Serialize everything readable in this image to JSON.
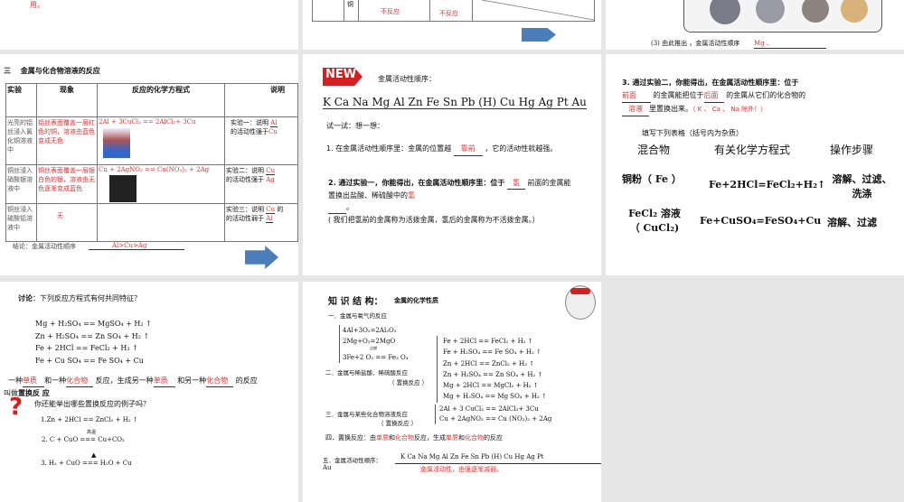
{
  "slides": [
    {
      "id": "top-left",
      "text": "用。"
    },
    {
      "id": "top-middle",
      "cell_label": "铜",
      "no_react1": "不反应",
      "no_react2": "不反应"
    },
    {
      "id": "top-right",
      "text": "(3) 由此推出 ，金属活动性顺序",
      "answer": "Mg 、"
    },
    {
      "id": "slide-metal-solution",
      "title": "三　 金属与化合物溶液的反应",
      "headers": [
        "实验",
        "现象",
        "反应的化学方程式",
        "说明"
      ],
      "rows": [
        {
          "exp": "光亮的铝丝浸入氯化铜溶液中",
          "phen": "铝丝表面覆盖一层红色的铜，溶液由蓝色变成无色",
          "eq": "2Al + 3CuCl₂ == 2AlCl₃+ 3Cu",
          "note": "实验一：说明",
          "note2": "的活动性强于",
          "a1": "Al",
          "a2": "Cu"
        },
        {
          "exp": "铜丝浸入硝酸银溶液中",
          "phen": "铜丝表面覆盖一层银白色的银，溶液由无色逐渐变成蓝色",
          "eq": "Cu + 2AgNO₃ == Cu(NO₃)₂ + 2Ag",
          "note": "实验二：说明",
          "note2": "的活动性强于",
          "a1": "Cu",
          "a2": "Ag"
        },
        {
          "exp": "铜丝浸入硫酸铝溶液中",
          "phen": "无",
          "eq": "",
          "note": "实验三：说明",
          "note2": "的活动性弱于",
          "a1": "Cu",
          "a2": "Al",
          "tail": "的"
        }
      ],
      "conclusion": "结论：金属活动性顺序",
      "conclusion_answer": "Al>Cu>Ag"
    },
    {
      "id": "slide-activity-series",
      "badge": "NEW",
      "title": "金属活动性顺序：",
      "series": "K Ca Na Mg Al Zn Fe Sn Pb (H) Cu Hg Ag Pt Au",
      "try": "试一试：想一想：",
      "q1a": "1. 在金属活动性顺序里：金属的位置越",
      "q1_ans": "靠前",
      "q1b": "，它的活动性就越强。",
      "q2a": "2. 通过实验一，你能得出，在金属活动性顺序里：位于",
      "q2_ans1": "氢",
      "q2b": "前面的金属能置换出盐酸、稀硫酸中的",
      "q2_ans2": "氢",
      "q2c": "。",
      "note": "( 我们把氢前的金属称为活拨金属，氢后的金属称为不活拨金属。）"
    },
    {
      "id": "slide-exp2",
      "q3a": "3. 通过实验二，你能得出，在金属活动性顺序里：位于",
      "a1": "前面",
      "q3b": "的金属能把位于",
      "a2": "后面",
      "q3c": "的金属从它们的化合物的",
      "a3": "溶液",
      "q3d": "里置换出来。",
      "exception": "（ K 、 Ca 、 Na 除外！）",
      "table_title": "填写下列表格（括号内为杂质）",
      "headers": [
        "混合物",
        "有关化学方程式",
        "操作步骤"
      ],
      "rows": [
        [
          "铜粉（ Fe ）",
          "Fe+2HCl=FeCl₂+H₂↑",
          "溶解、过滤、洗涤"
        ],
        [
          "FeCl₂ 溶液（ CuCl₂)",
          "Fe+CuSO₄=FeSO₄+Cu",
          "溶解、过滤"
        ]
      ]
    },
    {
      "id": "slide-discussion",
      "title_bold": "讨论",
      "title": "：下列反应方程式有何共同特征？",
      "eqs": [
        "Mg + H₂SO₄ == MgSO₄ + H₂ ↑",
        "Zn + H₂SO₄ == Zn SO₄ + H₂ ↑",
        "Fe + 2HCl == FeCl₂ + H₂ ↑",
        "Fe + Cu SO₄ == Fe SO₄ + Cu"
      ],
      "def": [
        "一种",
        "单质",
        "和一种",
        "化合物",
        "反应，生成另一种",
        "单质",
        "和另一种",
        "化合物",
        "的反应"
      ],
      "def2": "叫做",
      "def_bold": "置换反 应",
      "question": "你还能举出哪些置换反应的例子吗？",
      "examples": [
        "1.Zn + 2HCl == ZnCl₂ + H₂ ↑",
        "2. C + CuO === Cu+CO₂",
        "3. H₂ + CuO === H₂O + Cu"
      ],
      "cond": "高温"
    },
    {
      "id": "slide-knowledge",
      "title": "知 识 结 构：",
      "subtitle": "金属的化学性质",
      "s1": "一．金属与氧气的反应",
      "o2": [
        "4Al+3O₂=2Al₂O₃",
        "2Mg+O₂=2MgO",
        "3Fe+2 O₂ == Fe₃ O₄"
      ],
      "ignite": "点燃",
      "s2": "二．金属与稀盐酸、稀硫酸反应",
      "s2n": "（ 置换反应 ）",
      "acid": [
        "Fe + 2HCl == FeCl₂ + H₂ ↑",
        "Fe + H₂SO₄ == Fe SO₄ + H₂ ↑",
        "Zn + 2HCl == ZnCl₂ + H₂ ↑",
        "Zn + H₂SO₄ == Zn SO₄ + H₂ ↑",
        "Mg + 2HCl == MgCl₂ + H₂ ↑",
        "Mg + H₂SO₄ == Mg SO₄ + H₂ ↑"
      ],
      "s3": "三．金属与某些化合物溶液反应",
      "s3n": "（ 置换反应 ）",
      "salt": [
        "2Al + 3 CuCl₂ == 2AlCl₃+ 3Cu",
        "Cu + 2AgNO₃ == Cu (NO₃)₂ + 2Ag"
      ],
      "s4": [
        "四．置换反应：由",
        "单质",
        "和",
        "化合物",
        "反应，生成",
        "单质",
        "和",
        "化合物",
        "的反应"
      ],
      "s5": "五．金属活动性顺序：",
      "s5series": "K Ca Na Mg Al Zn Fe Sn Pb (H) Cu Hg Ag Pt",
      "s5au": "Au",
      "s5note": "金属活动性，由强逐渐减弱。"
    }
  ],
  "colors": {
    "accent_red": "#e03030",
    "arrow_blue": "#4a7ebb",
    "background": "#e6e6e6"
  }
}
